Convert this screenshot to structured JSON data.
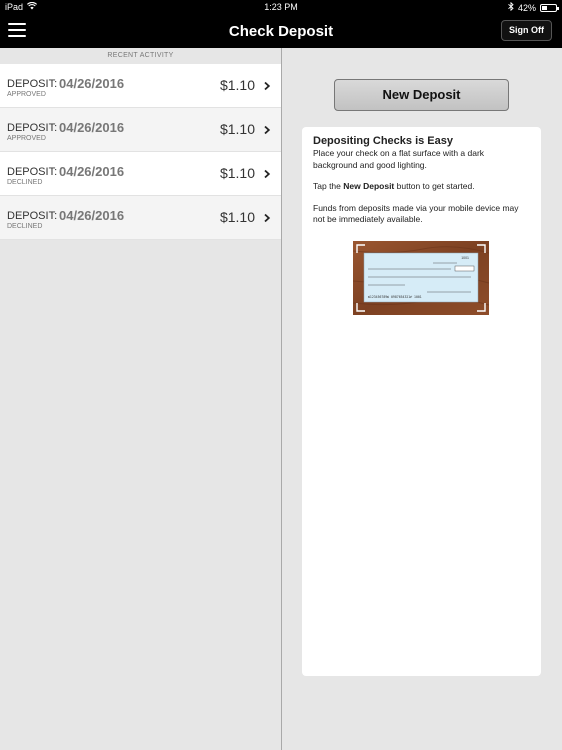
{
  "status_bar": {
    "carrier": "iPad",
    "time": "1:23 PM",
    "battery_percent": "42%",
    "battery_level": 0.42,
    "icons": [
      "wifi-icon",
      "bluetooth-icon",
      "battery-icon"
    ]
  },
  "nav": {
    "title": "Check Deposit",
    "signoff_label": "Sign Off",
    "menu_icon": "hamburger-menu-icon"
  },
  "recent_activity": {
    "header": "RECENT ACTIVITY",
    "rows": [
      {
        "type": "DEPOSIT:",
        "date": "04/26/2016",
        "status": "APPROVED",
        "amount": "$1.10"
      },
      {
        "type": "DEPOSIT:",
        "date": "04/26/2016",
        "status": "APPROVED",
        "amount": "$1.10"
      },
      {
        "type": "DEPOSIT:",
        "date": "04/26/2016",
        "status": "DECLINED",
        "amount": "$1.10"
      },
      {
        "type": "DEPOSIT:",
        "date": "04/26/2016",
        "status": "DECLINED",
        "amount": "$1.10"
      }
    ]
  },
  "new_deposit": {
    "label": "New Deposit"
  },
  "info": {
    "title": "Depositing Checks is Easy",
    "p1": "Place your check on a flat surface with a dark background and good lighting.",
    "p2_prefix": "Tap the ",
    "p2_bold": "New Deposit",
    "p2_suffix": " button to get started.",
    "p3": "Funds from deposits made via your mobile device may not be immediately available.",
    "check": {
      "number": "1001",
      "micr": "⑆123456789⑆ 0987654321⑈ 1001"
    }
  },
  "colors": {
    "nav_bg": "#000000",
    "panel_bg": "#e6e6e6",
    "wood": "#8b4a28",
    "check_blue": "#d6ecf7"
  }
}
